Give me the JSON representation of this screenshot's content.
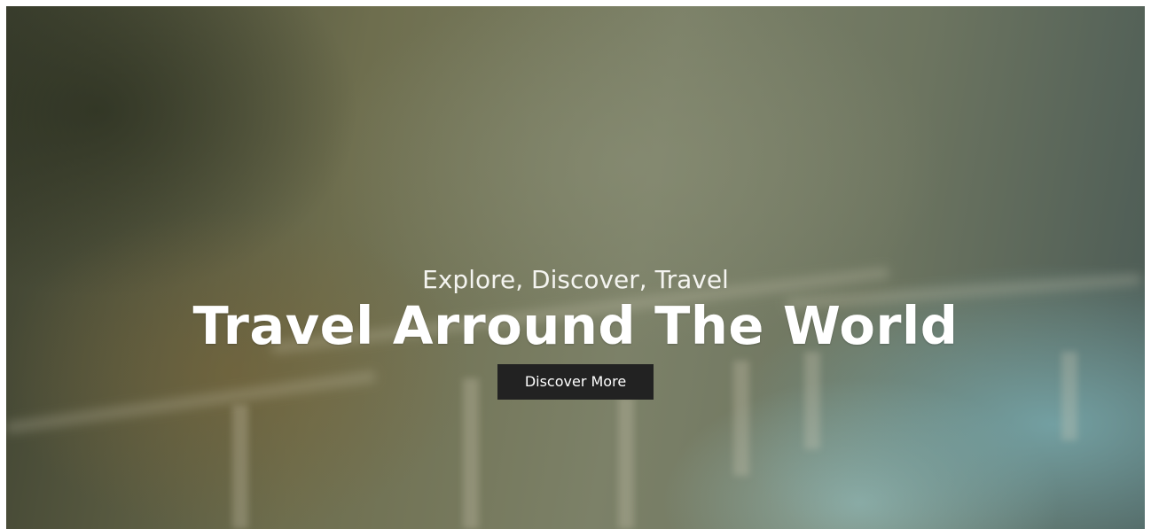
{
  "hero": {
    "subtitle": "Explore, Discover, Travel",
    "title": "Travel Arround The World",
    "cta_label": "Discover More"
  },
  "colors": {
    "button_bg": "#222222",
    "text": "#ffffff"
  }
}
